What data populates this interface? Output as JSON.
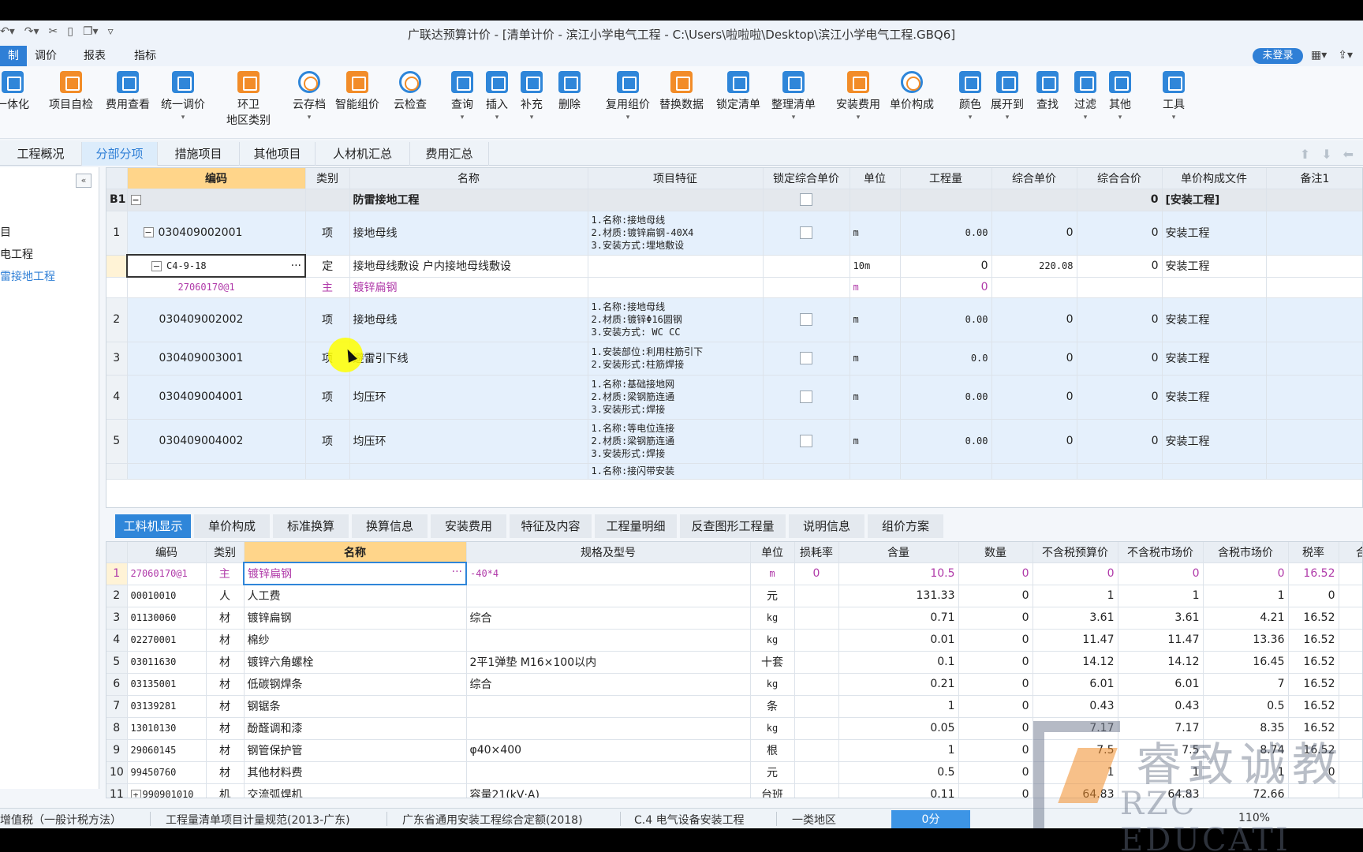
{
  "window": {
    "title": "广联达预算计价 - [清单计价 - 滨江小学电气工程 - C:\\Users\\啦啦啦\\Desktop\\滨江小学电气工程.GBQ6]",
    "login": "未登录"
  },
  "menus": [
    "制",
    "调价",
    "报表",
    "指标"
  ],
  "ribbon": [
    {
      "label": "一体化"
    },
    {
      "label": "项目自检"
    },
    {
      "label": "费用查看"
    },
    {
      "label": "统一调价"
    },
    {
      "label": "环卫",
      "label2": "地区类别"
    },
    {
      "label": "云存档"
    },
    {
      "label": "智能组价"
    },
    {
      "label": "云检查"
    },
    {
      "label": "查询"
    },
    {
      "label": "插入"
    },
    {
      "label": "补充"
    },
    {
      "label": "删除"
    },
    {
      "label": "复用组价"
    },
    {
      "label": "替换数据"
    },
    {
      "label": "锁定清单"
    },
    {
      "label": "整理清单"
    },
    {
      "label": "安装费用"
    },
    {
      "label": "单价构成"
    },
    {
      "label": "颜色"
    },
    {
      "label": "展开到"
    },
    {
      "label": "查找"
    },
    {
      "label": "过滤"
    },
    {
      "label": "其他"
    },
    {
      "label": "工具"
    }
  ],
  "tabs": [
    "工程概况",
    "分部分项",
    "措施项目",
    "其他项目",
    "人材机汇总",
    "费用汇总"
  ],
  "left_panel": {
    "items": [
      "目",
      "电工程",
      "雷接地工程"
    ]
  },
  "upper_grid": {
    "headers": [
      "编码",
      "类别",
      "名称",
      "项目特征",
      "锁定综合单价",
      "单位",
      "工程量",
      "综合单价",
      "综合合价",
      "单价构成文件",
      "备注1"
    ],
    "group": {
      "idx": "B1",
      "name": "防雷接地工程",
      "total": "0",
      "file": "[安装工程]"
    },
    "rows": [
      {
        "idx": "1",
        "code": "030409002001",
        "type": "项",
        "name": "接地母线",
        "feat": "1.名称:接地母线\n2.材质:镀锌扁钢-40X4\n3.安装方式:埋地敷设",
        "unit": "m",
        "qty": "0.00",
        "price": "0",
        "total": "0",
        "file": "安装工程"
      },
      {
        "idx": "",
        "code": "C4-9-18",
        "type": "定",
        "name": "接地母线敷设 户内接地母线敷设",
        "feat": "",
        "unit": "10m",
        "qty": "0",
        "price": "220.08",
        "total": "0",
        "file": "安装工程"
      },
      {
        "idx": "",
        "code": "27060170@1",
        "type": "主",
        "name": "镀锌扁钢",
        "feat": "",
        "unit": "m",
        "qty": "0",
        "price": "",
        "total": "",
        "file": ""
      },
      {
        "idx": "2",
        "code": "030409002002",
        "type": "项",
        "name": "接地母线",
        "feat": "1.名称:接地母线\n2.材质:镀锌Φ16圆钢\n3.安装方式: WC CC",
        "unit": "m",
        "qty": "0.00",
        "price": "0",
        "total": "0",
        "file": "安装工程"
      },
      {
        "idx": "3",
        "code": "030409003001",
        "type": "项",
        "name": "避雷引下线",
        "feat": "1.安装部位:利用柱筋引下\n2.安装形式:柱筋焊接",
        "unit": "m",
        "qty": "0.0",
        "price": "0",
        "total": "0",
        "file": "安装工程"
      },
      {
        "idx": "4",
        "code": "030409004001",
        "type": "项",
        "name": "均压环",
        "feat": "1.名称:基础接地网\n2.材质:梁钢筋连通\n3.安装形式:焊接",
        "unit": "m",
        "qty": "0.00",
        "price": "0",
        "total": "0",
        "file": "安装工程"
      },
      {
        "idx": "5",
        "code": "030409004002",
        "type": "项",
        "name": "均压环",
        "feat": "1.名称:等电位连接\n2.材质:梁钢筋连通\n3.安装形式:焊接",
        "unit": "m",
        "qty": "0.00",
        "price": "0",
        "total": "0",
        "file": "安装工程"
      },
      {
        "idx": "",
        "code": "",
        "type": "",
        "name": "",
        "feat": "1.名称:接闪带安装",
        "unit": "",
        "qty": "",
        "price": "",
        "total": "",
        "file": ""
      }
    ]
  },
  "lower_tabs": [
    "工料机显示",
    "单价构成",
    "标准换算",
    "换算信息",
    "安装费用",
    "特征及内容",
    "工程量明细",
    "反查图形工程量",
    "说明信息",
    "组价方案"
  ],
  "lower_grid": {
    "headers": [
      "编码",
      "类别",
      "名称",
      "规格及型号",
      "单位",
      "损耗率",
      "含量",
      "数量",
      "不含税预算价",
      "不含税市场价",
      "含税市场价",
      "税率",
      "合"
    ],
    "rows": [
      {
        "idx": "1",
        "code": "27060170@1",
        "type": "主",
        "name": "镀锌扁钢",
        "spec": "-40*4",
        "unit": "m",
        "loss": "0",
        "content": "10.5",
        "qty": "0",
        "p1": "0",
        "p2": "0",
        "p3": "0",
        "tax": "16.52"
      },
      {
        "idx": "2",
        "code": "00010010",
        "type": "人",
        "name": "人工费",
        "spec": "",
        "unit": "元",
        "loss": "",
        "content": "131.33",
        "qty": "0",
        "p1": "1",
        "p2": "1",
        "p3": "1",
        "tax": "0"
      },
      {
        "idx": "3",
        "code": "01130060",
        "type": "材",
        "name": "镀锌扁钢",
        "spec": "综合",
        "unit": "kg",
        "loss": "",
        "content": "0.71",
        "qty": "0",
        "p1": "3.61",
        "p2": "3.61",
        "p3": "4.21",
        "tax": "16.52"
      },
      {
        "idx": "4",
        "code": "02270001",
        "type": "材",
        "name": "棉纱",
        "spec": "",
        "unit": "kg",
        "loss": "",
        "content": "0.01",
        "qty": "0",
        "p1": "11.47",
        "p2": "11.47",
        "p3": "13.36",
        "tax": "16.52"
      },
      {
        "idx": "5",
        "code": "03011630",
        "type": "材",
        "name": "镀锌六角螺栓",
        "spec": "2平1弹垫 M16×100以内",
        "unit": "十套",
        "loss": "",
        "content": "0.1",
        "qty": "0",
        "p1": "14.12",
        "p2": "14.12",
        "p3": "16.45",
        "tax": "16.52"
      },
      {
        "idx": "6",
        "code": "03135001",
        "type": "材",
        "name": "低碳钢焊条",
        "spec": "综合",
        "unit": "kg",
        "loss": "",
        "content": "0.21",
        "qty": "0",
        "p1": "6.01",
        "p2": "6.01",
        "p3": "7",
        "tax": "16.52"
      },
      {
        "idx": "7",
        "code": "03139281",
        "type": "材",
        "name": "钢锯条",
        "spec": "",
        "unit": "条",
        "loss": "",
        "content": "1",
        "qty": "0",
        "p1": "0.43",
        "p2": "0.43",
        "p3": "0.5",
        "tax": "16.52"
      },
      {
        "idx": "8",
        "code": "13010130",
        "type": "材",
        "name": "酚醛调和漆",
        "spec": "",
        "unit": "kg",
        "loss": "",
        "content": "0.05",
        "qty": "0",
        "p1": "7.17",
        "p2": "7.17",
        "p3": "8.35",
        "tax": "16.52"
      },
      {
        "idx": "9",
        "code": "29060145",
        "type": "材",
        "name": "钢管保护管",
        "spec": "φ40×400",
        "unit": "根",
        "loss": "",
        "content": "1",
        "qty": "0",
        "p1": "7.5",
        "p2": "7.5",
        "p3": "8.74",
        "tax": "16.52"
      },
      {
        "idx": "10",
        "code": "99450760",
        "type": "材",
        "name": "其他材料费",
        "spec": "",
        "unit": "元",
        "loss": "",
        "content": "0.5",
        "qty": "0",
        "p1": "1",
        "p2": "1",
        "p3": "1",
        "tax": "0"
      },
      {
        "idx": "11",
        "code": "990901010",
        "type": "机",
        "name": "交流弧焊机",
        "spec": "容量21(kV·A)",
        "unit": "台班",
        "loss": "",
        "content": "0.11",
        "qty": "0",
        "p1": "64.83",
        "p2": "64.83",
        "p3": "72.66",
        "tax": ""
      }
    ]
  },
  "status": {
    "items": [
      "增值税（一般计税方法）",
      "工程量清单项目计量规范(2013-广东)",
      "广东省通用安装工程综合定额(2018)",
      "C.4 电气设备安装工程",
      "一类地区"
    ],
    "score": "0分",
    "zoom": "110%"
  },
  "watermark": {
    "cn": "睿致诚教",
    "en": "RZC EDUCATI"
  },
  "colors": {
    "accent": "#2f86d9",
    "main_material": "#b03aa9",
    "highlight_header": "#ffd58a"
  }
}
